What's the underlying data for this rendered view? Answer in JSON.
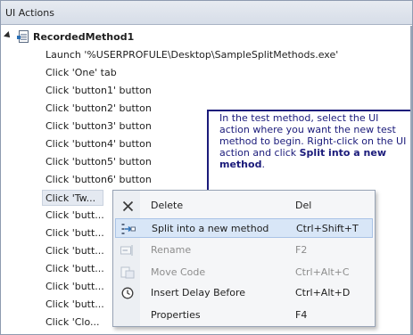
{
  "panel": {
    "title": "UI Actions"
  },
  "tree": {
    "root_label": "RecordedMethod1",
    "items": [
      "Launch '%USERPROFULE\\Desktop\\SampleSplitMethods.exe'",
      "Click 'One' tab",
      "Click 'button1' button",
      "Click 'button2' button",
      "Click 'button3' button",
      "Click 'button4' button",
      "Click 'button5' button",
      "Click 'button6' button",
      "Click 'Tw...",
      "Click 'butt...",
      "Click 'butt...",
      "Click 'butt...",
      "Click 'butt...",
      "Click 'butt...",
      "Click 'butt...",
      "Click 'Clo..."
    ],
    "selected_index": 8
  },
  "callout": {
    "text_before": "In the test method, select the UI action where you want the new test method to begin. Right-click on the UI action and click ",
    "bold": "Split into a new method",
    "text_after": "."
  },
  "context_menu": {
    "items": [
      {
        "label": "Delete",
        "shortcut": "Del",
        "icon": "delete-x-icon",
        "disabled": false,
        "highlight": false
      },
      {
        "label": "Split into a new method",
        "shortcut": "Ctrl+Shift+T",
        "icon": "split-method-icon",
        "disabled": false,
        "highlight": true
      },
      {
        "label": "Rename",
        "shortcut": "F2",
        "icon": "rename-icon",
        "disabled": true,
        "highlight": false
      },
      {
        "label": "Move Code",
        "shortcut": "Ctrl+Alt+C",
        "icon": "move-code-icon",
        "disabled": true,
        "highlight": false
      },
      {
        "label": "Insert Delay Before",
        "shortcut": "Ctrl+Alt+D",
        "icon": "delay-clock-icon",
        "disabled": false,
        "highlight": false
      },
      {
        "label": "Properties",
        "shortcut": "F4",
        "icon": "",
        "disabled": false,
        "highlight": false
      }
    ]
  },
  "colors": {
    "callout": "#1a1a7a",
    "highlight": "#d8e6f7"
  }
}
